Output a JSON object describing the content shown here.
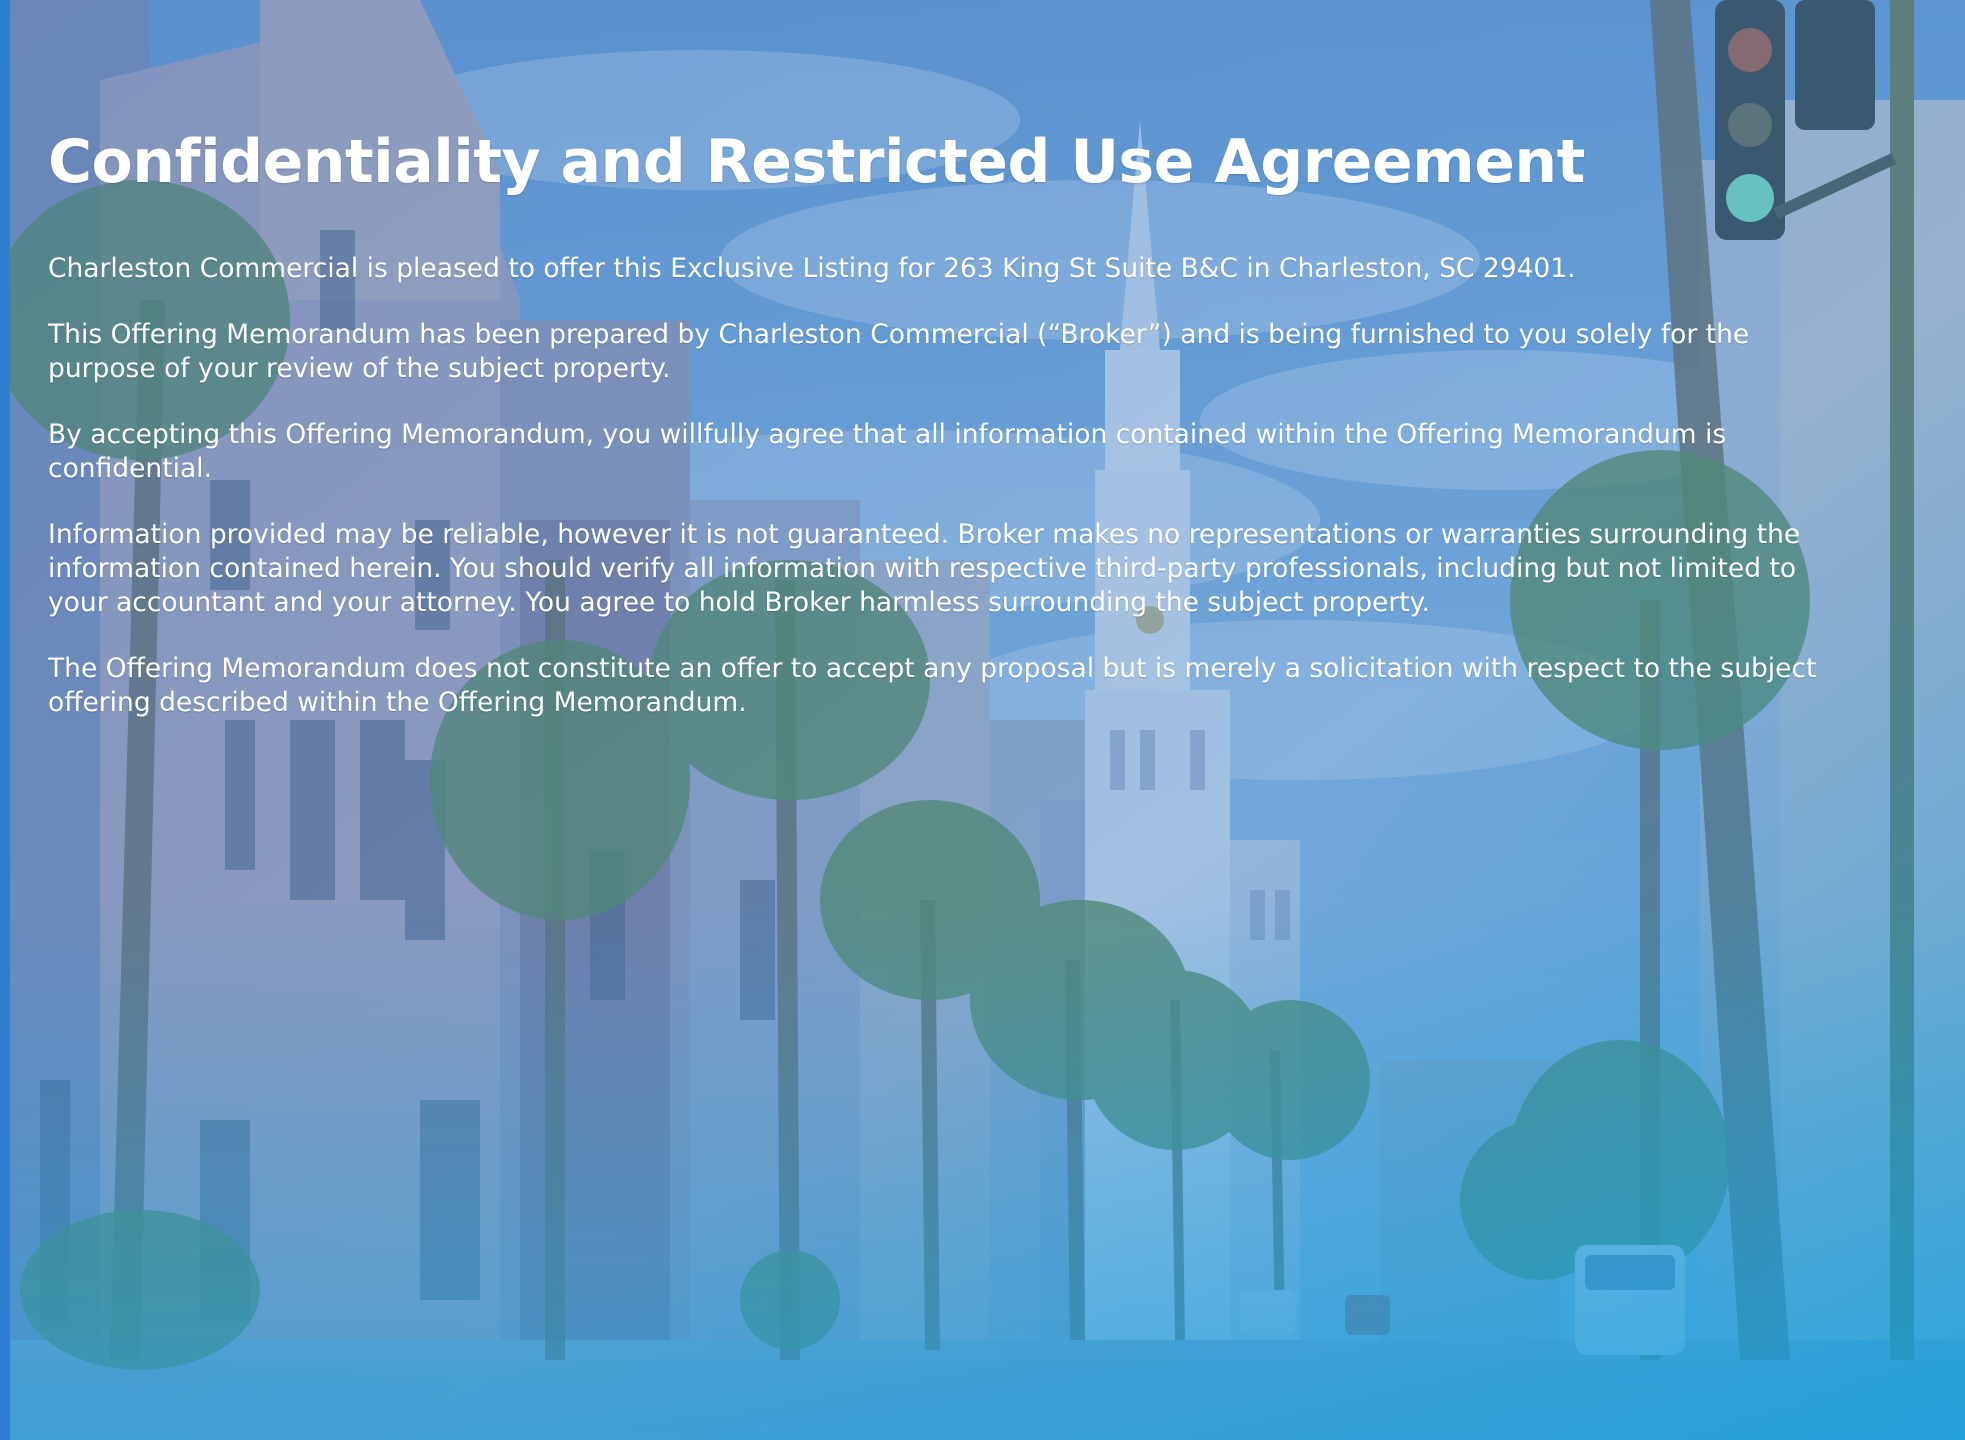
{
  "document": {
    "title": "Confidentiality and Restricted Use Agreement",
    "paragraphs": [
      "Charleston Commercial is pleased to offer this Exclusive Listing for 263 King St Suite B&C in Charleston, SC 29401.",
      "This Offering Memorandum has been prepared by Charleston Commercial (“Broker”) and is being furnished to you solely for the purpose of your review of the subject property.",
      "By accepting this Offering Memorandum, you willfully agree that all information contained within the Offering Memorandum is confidential.",
      "Information provided may be reliable, however it is not guaranteed. Broker makes no representations or warranties surrounding the information contained herein. You should verify all information with respective third-party professionals, including but not limited to your accountant and your attorney. You agree to hold Broker harmless surrounding the subject property.",
      "The Offering Memorandum does not constitute an offer to accept any proposal but is merely a solicitation with respect to the subject offering described within the Offering Memorandum."
    ]
  },
  "colors": {
    "overlay_top": "#4a86c8",
    "overlay_bottom": "#1f9ad6",
    "accent_stripe": "#2f7fd1",
    "text": "#ffffff"
  }
}
